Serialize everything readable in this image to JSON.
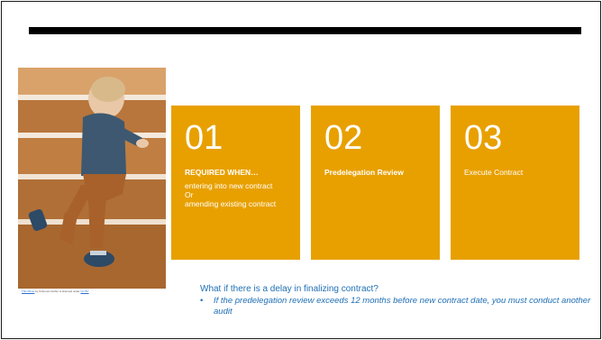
{
  "photo": {
    "alt": "Toddler climbing wooden stairs",
    "caption_link": "This Photo",
    "caption_mid": " by Unknown Author is licensed under ",
    "caption_license": "CC BY"
  },
  "cards": [
    {
      "number": "01",
      "heading": "REQUIRED WHEN…",
      "lines": [
        "entering into new contract",
        "Or",
        "amending existing contract"
      ]
    },
    {
      "number": "02",
      "heading": "Predelegation Review"
    },
    {
      "number": "03",
      "text": "Execute Contract"
    }
  ],
  "note": {
    "question": "What if there is a delay in finalizing contract?",
    "bullet": "•",
    "detail": "If the predelegation review exceeds 12 months before new contract date, you must conduct another audit"
  },
  "colors": {
    "card": "#e8a000",
    "note_text": "#1f6fb5",
    "title_bar": "#000000"
  }
}
